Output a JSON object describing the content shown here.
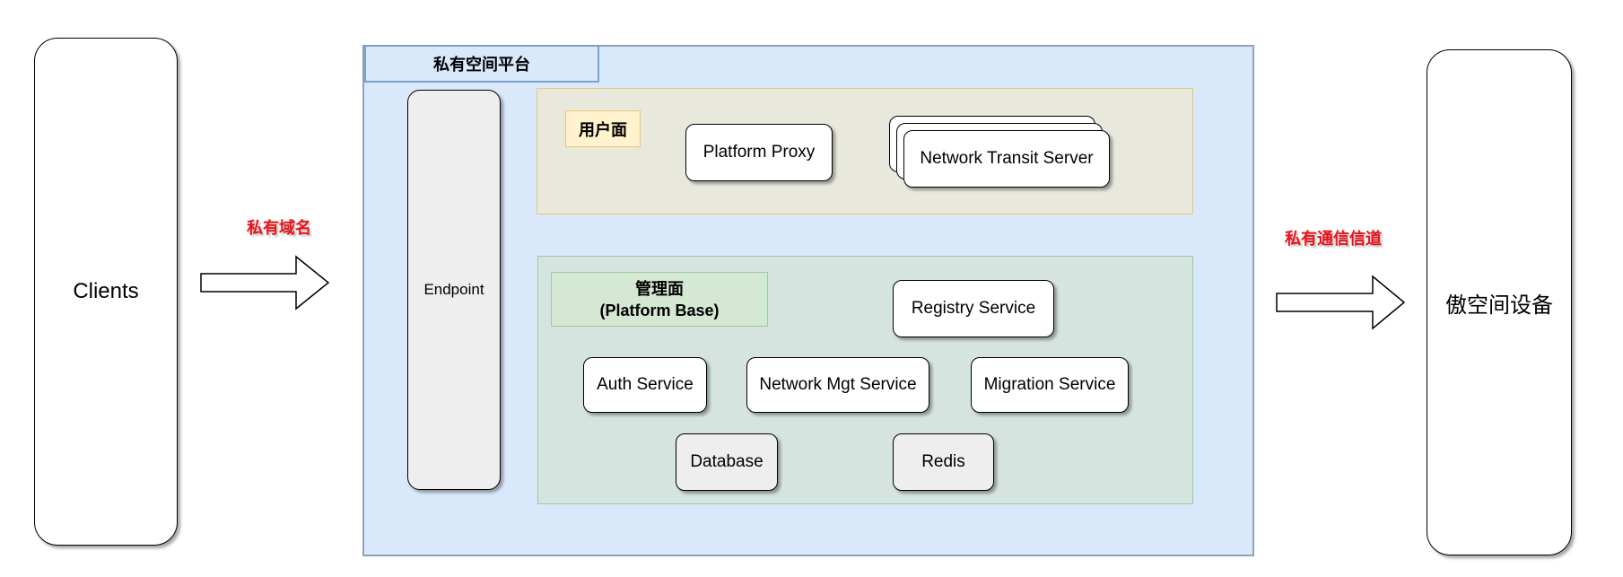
{
  "diagram": {
    "clients": "Clients",
    "devices": "傲空间设备",
    "label_domain": "私有域名",
    "label_channel": "私有通信信道",
    "platform": {
      "title": "私有空间平台",
      "endpoint": "Endpoint",
      "user_plane": {
        "title": "用户面",
        "platform_proxy": "Platform Proxy",
        "network_transit_server": "Network Transit Server"
      },
      "mgmt_plane": {
        "title_line1": "管理面",
        "title_line2": "(Platform Base)",
        "registry_service": "Registry Service",
        "auth_service": "Auth Service",
        "network_mgt_service": "Network Mgt Service",
        "migration_service": "Migration Service",
        "database": "Database",
        "redis": "Redis"
      }
    }
  },
  "colors": {
    "platform_fill": "#dae8fc",
    "platform_border": "#8fa2b8",
    "user_plane_fill": "#e9e8dd",
    "user_plane_border": "#e6c975",
    "mgmt_plane_fill": "#d5e4df",
    "mgmt_plane_border": "#9ccc9c",
    "label_red": "#e8131a"
  }
}
